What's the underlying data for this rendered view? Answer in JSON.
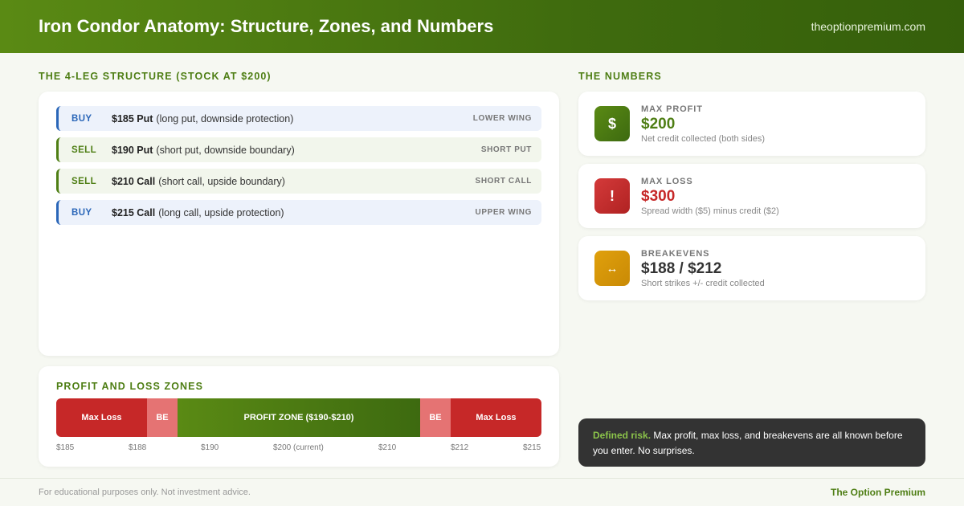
{
  "header": {
    "title": "Iron Condor Anatomy: Structure, Zones, and Numbers",
    "site": "theoptionpremium.com"
  },
  "structure": {
    "label": "THE 4-LEG STRUCTURE (STOCK AT $200)",
    "legs": [
      {
        "action": "BUY",
        "strike": "$185 Put",
        "desc": "(long put, downside protection)",
        "tag": "LOWER WING"
      },
      {
        "action": "SELL",
        "strike": "$190 Put",
        "desc": "(short put, downside boundary)",
        "tag": "SHORT PUT"
      },
      {
        "action": "SELL",
        "strike": "$210 Call",
        "desc": "(short call, upside boundary)",
        "tag": "SHORT CALL"
      },
      {
        "action": "BUY",
        "strike": "$215 Call",
        "desc": "(long call, upside protection)",
        "tag": "UPPER WING"
      }
    ]
  },
  "zones": {
    "label": "PROFIT AND LOSS ZONES",
    "segments": [
      {
        "text": "Max Loss",
        "kind": "loss"
      },
      {
        "text": "BE",
        "kind": "be"
      },
      {
        "text": "PROFIT ZONE ($190-$210)",
        "kind": "profit"
      },
      {
        "text": "BE",
        "kind": "be"
      },
      {
        "text": "Max Loss",
        "kind": "loss"
      }
    ],
    "ticks": [
      "$185",
      "$188",
      "$190",
      "$200 (current)",
      "$210",
      "$212",
      "$215"
    ]
  },
  "numbers": {
    "label": "THE NUMBERS",
    "cards": [
      {
        "icon": "dollar-icon",
        "glyph": "$",
        "label": "MAX PROFIT",
        "value": "$200",
        "sub": "Net credit collected (both sides)",
        "color": "#4e7e14"
      },
      {
        "icon": "alert-icon",
        "glyph": "!",
        "label": "MAX LOSS",
        "value": "$300",
        "sub": "Spread width ($5) minus credit ($2)",
        "color": "#c62828"
      },
      {
        "icon": "arrows-icon",
        "glyph": "↔",
        "label": "BREAKEVENS",
        "value": "$188 / $212",
        "sub": "Short strikes +/- credit collected",
        "color": "#333333"
      }
    ]
  },
  "note": {
    "highlight": "Defined risk.",
    "text": " Max profit, max loss, and breakevens are all known before you enter. No surprises."
  },
  "footer": {
    "disclaimer": "For educational purposes only. Not investment advice.",
    "brand": "The Option Premium"
  }
}
